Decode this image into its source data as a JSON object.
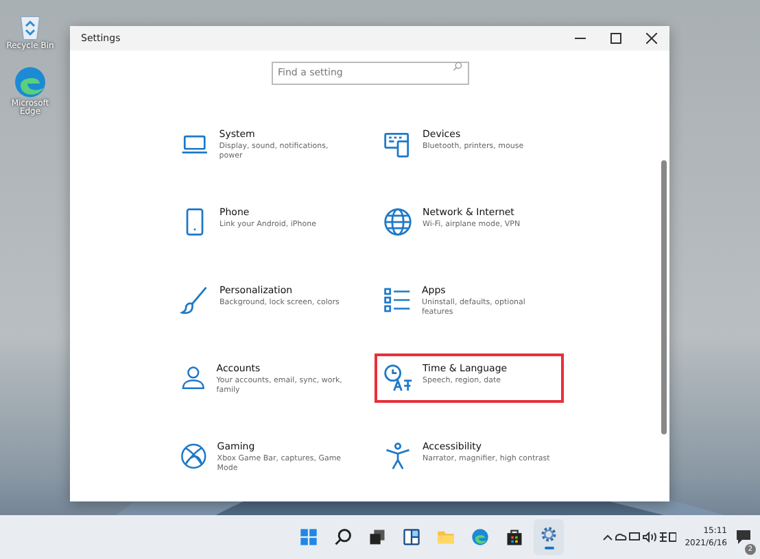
{
  "desktop_icons": [
    {
      "kind": "bin",
      "label": "Recycle Bin"
    },
    {
      "kind": "edge",
      "label": "Microsoft Edge"
    }
  ],
  "window": {
    "title": "Settings",
    "search": {
      "placeholder": "Find a setting"
    },
    "items": [
      {
        "kind": "laptop",
        "title": "System",
        "subtitle": "Display, sound, notifications, power",
        "highlighted": false
      },
      {
        "kind": "devices",
        "title": "Devices",
        "subtitle": "Bluetooth, printers, mouse",
        "highlighted": false
      },
      {
        "kind": "phone",
        "title": "Phone",
        "subtitle": "Link your Android, iPhone",
        "highlighted": false
      },
      {
        "kind": "globe",
        "title": "Network & Internet",
        "subtitle": "Wi-Fi, airplane mode, VPN",
        "highlighted": false
      },
      {
        "kind": "brush",
        "title": "Personalization",
        "subtitle": "Background, lock screen, colors",
        "highlighted": false
      },
      {
        "kind": "apps",
        "title": "Apps",
        "subtitle": "Uninstall, defaults, optional features",
        "highlighted": false
      },
      {
        "kind": "person",
        "title": "Accounts",
        "subtitle": "Your accounts, email, sync, work, family",
        "highlighted": false
      },
      {
        "kind": "time",
        "title": "Time & Language",
        "subtitle": "Speech, region, date",
        "highlighted": true
      },
      {
        "kind": "xbox",
        "title": "Gaming",
        "subtitle": "Xbox Game Bar, captures, Game Mode",
        "highlighted": false
      },
      {
        "kind": "access",
        "title": "Accessibility",
        "subtitle": "Narrator, magnifier, high contrast",
        "highlighted": false
      }
    ]
  },
  "taskbar": {
    "apps": [
      {
        "kind": "start",
        "selected": false
      },
      {
        "kind": "search",
        "selected": false
      },
      {
        "kind": "taskview",
        "selected": false
      },
      {
        "kind": "widgets",
        "selected": false
      },
      {
        "kind": "folder",
        "selected": false
      },
      {
        "kind": "edge",
        "selected": false
      },
      {
        "kind": "store",
        "selected": false
      },
      {
        "kind": "settings",
        "selected": true
      }
    ],
    "time": "15:11",
    "date": "2021/6/16",
    "notifications": "2"
  }
}
